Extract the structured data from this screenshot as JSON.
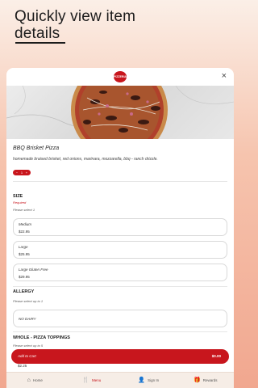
{
  "promo": {
    "line1": "Quickly view item",
    "line2": "details"
  },
  "header": {
    "logo_text": "PIZZERIA",
    "close_icon": "×"
  },
  "item": {
    "name": "BBQ Brisket Pizza",
    "description": "homemade braised brisket, red onions, marinara, mozzarella, bbq - ranch drizzle.",
    "quantity": {
      "minus": "−",
      "value": "1",
      "plus": "+"
    }
  },
  "size": {
    "title": "SIZE",
    "required": "Required",
    "instruction": "Please select 1",
    "options": [
      {
        "name": "Medium",
        "price": "$22.95"
      },
      {
        "name": "Large",
        "price": "$25.95"
      },
      {
        "name": "Large Gluten Free",
        "price": "$29.95"
      }
    ]
  },
  "allergy": {
    "title": "ALLERGY",
    "instruction": "Please select up to 1",
    "options": [
      {
        "name": "NO DAIRY"
      }
    ]
  },
  "toppings": {
    "title": "WHOLE - PIZZA TOPPINGS",
    "instruction": "Please select up to 5",
    "peek_price": "$2.25"
  },
  "cart": {
    "label": "Add to Cart",
    "total": "$0.00"
  },
  "tabs": [
    {
      "label": "Home",
      "icon": "home-icon",
      "glyph": "⌂"
    },
    {
      "label": "Menu",
      "icon": "menu-icon",
      "glyph": "🍴"
    },
    {
      "label": "Sign In",
      "icon": "user-icon",
      "glyph": "👤"
    },
    {
      "label": "Rewards",
      "icon": "rewards-icon",
      "glyph": "🎁"
    }
  ],
  "colors": {
    "accent": "#c8161d",
    "bg_top": "#fbefe7",
    "bg_bottom": "#f1a78f"
  }
}
